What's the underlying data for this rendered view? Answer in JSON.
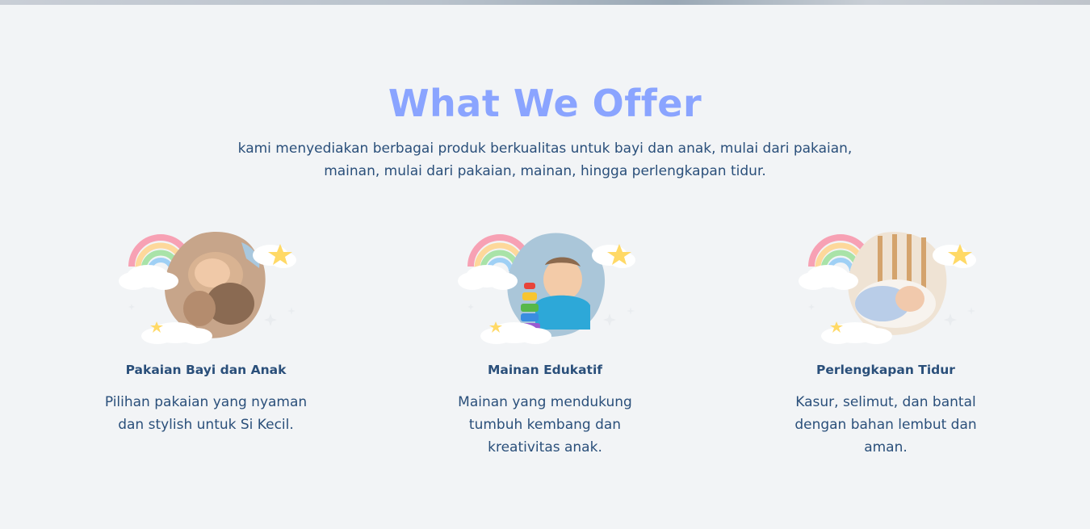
{
  "section": {
    "title": "What We Offer",
    "subtitle": "kami menyediakan berbagai produk berkualitas untuk bayi dan anak, mulai dari pakaian, mainan, mulai dari pakaian, mainan, hingga perlengkapan tidur."
  },
  "cards": [
    {
      "title": "Pakaian Bayi dan Anak",
      "description": "Pilihan pakaian yang nyaman dan stylish untuk Si Kecil.",
      "icon": "baby-clothing-illustration"
    },
    {
      "title": "Mainan Edukatif",
      "description": "Mainan yang mendukung tumbuh kembang dan kreativitas anak.",
      "icon": "educational-toy-illustration"
    },
    {
      "title": "Perlengkapan Tidur",
      "description": "Kasur, selimut, dan bantal dengan bahan lembut dan aman.",
      "icon": "baby-bedding-illustration"
    }
  ],
  "colors": {
    "background": "#f2f4f6",
    "title": "#8aa4ff",
    "text": "#2a4f7a",
    "star": "#ffd966"
  }
}
